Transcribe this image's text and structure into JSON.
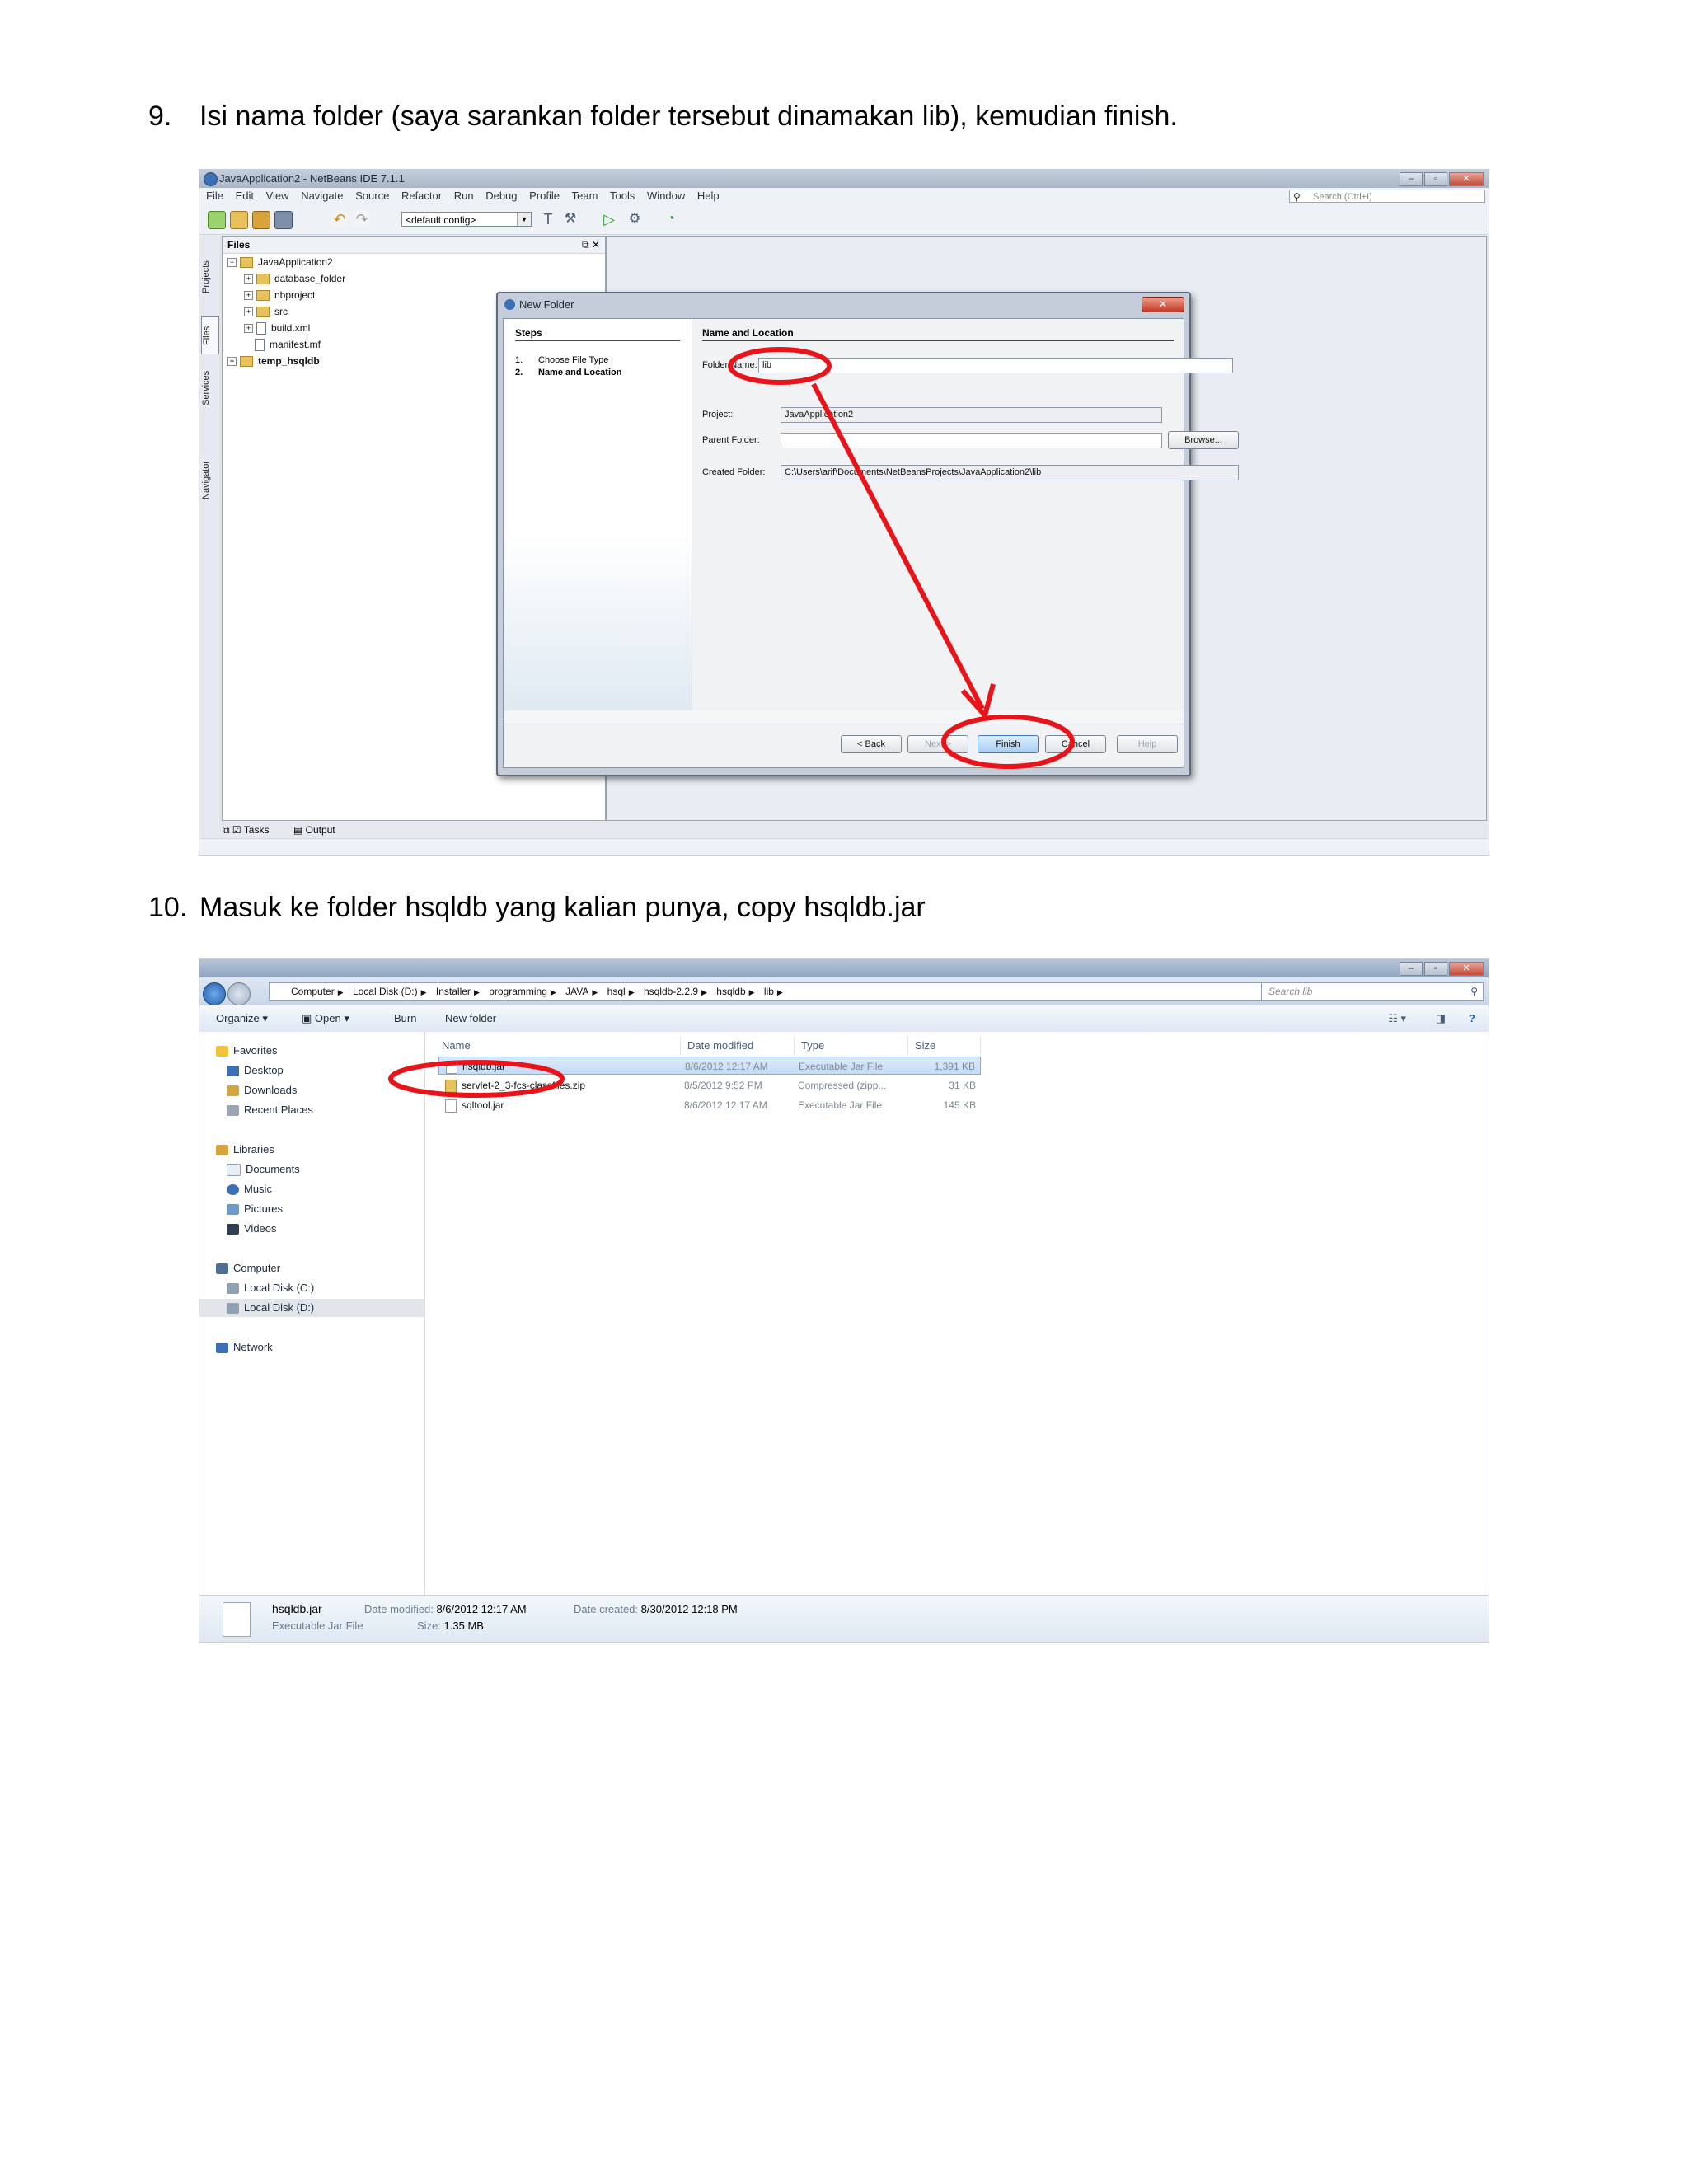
{
  "steps": [
    {
      "number": "9.",
      "text": "Isi nama folder (saya sarankan folder tersebut dinamakan lib), kemudian finish."
    },
    {
      "number": "10.",
      "text": "Masuk ke folder hsqldb yang kalian punya, copy hsqldb.jar"
    }
  ],
  "netbeans": {
    "window_title": "JavaApplication2 - NetBeans IDE 7.1.1",
    "menu": [
      "File",
      "Edit",
      "View",
      "Navigate",
      "Source",
      "Refactor",
      "Run",
      "Debug",
      "Profile",
      "Team",
      "Tools",
      "Window",
      "Help"
    ],
    "search_placeholder": "Search (Ctrl+I)",
    "config": "<default config>",
    "side_tabs": [
      "Projects",
      "Files",
      "Services",
      "Navigator"
    ],
    "files_panel_title": "Files",
    "tree": [
      "JavaApplication2",
      "database_folder",
      "nbproject",
      "src",
      "build.xml",
      "manifest.mf",
      "temp_hsqldb"
    ],
    "bottom_tabs": [
      "Tasks",
      "Output"
    ],
    "dialog": {
      "title": "New Folder",
      "steps_title": "Steps",
      "steps": [
        {
          "n": "1.",
          "label": "Choose File Type"
        },
        {
          "n": "2.",
          "label": "Name and Location"
        }
      ],
      "section_title": "Name and Location",
      "folder_name_label": "Folder Name:",
      "folder_name_value": "lib",
      "project_label": "Project:",
      "project_value": "JavaApplication2",
      "parent_folder_label": "Parent Folder:",
      "parent_folder_value": "",
      "browse": "Browse...",
      "created_folder_label": "Created Folder:",
      "created_folder_value": "C:\\Users\\arif\\Documents\\NetBeansProjects\\JavaApplication2\\lib",
      "buttons": {
        "back": "< Back",
        "next": "Next >",
        "finish": "Finish",
        "cancel": "Cancel",
        "help": "Help"
      }
    }
  },
  "explorer": {
    "breadcrumb": [
      "Computer",
      "Local Disk (D:)",
      "Installer",
      "programming",
      "JAVA",
      "hsql",
      "hsqldb-2.2.9",
      "hsqldb",
      "lib"
    ],
    "search_placeholder": "Search lib",
    "commands": {
      "organize": "Organize ▾",
      "open": "Open ▾",
      "burn": "Burn",
      "new_folder": "New folder"
    },
    "nav": {
      "favorites": "Favorites",
      "desktop": "Desktop",
      "downloads": "Downloads",
      "recent": "Recent Places",
      "libraries": "Libraries",
      "documents": "Documents",
      "music": "Music",
      "pictures": "Pictures",
      "videos": "Videos",
      "computer": "Computer",
      "local_c": "Local Disk (C:)",
      "local_d": "Local Disk (D:)",
      "network": "Network"
    },
    "columns": {
      "name": "Name",
      "date": "Date modified",
      "type": "Type",
      "size": "Size"
    },
    "files": [
      {
        "name": "hsqldb.jar",
        "date": "8/6/2012 12:17 AM",
        "type": "Executable Jar File",
        "size": "1,391 KB"
      },
      {
        "name": "servlet-2_3-fcs-classfiles.zip",
        "date": "8/5/2012 9:52 PM",
        "type": "Compressed (zipp...",
        "size": "31 KB"
      },
      {
        "name": "sqltool.jar",
        "date": "8/6/2012 12:17 AM",
        "type": "Executable Jar File",
        "size": "145 KB"
      }
    ],
    "details": {
      "name": "hsqldb.jar",
      "kind": "Executable Jar File",
      "modified_label": "Date modified:",
      "modified": "8/6/2012 12:17 AM",
      "created_label": "Date created:",
      "created": "8/30/2012 12:18 PM",
      "size_label": "Size:",
      "size": "1.35 MB"
    }
  },
  "colors": {
    "annotation": "#e8141a",
    "selection": "#c4dcf7"
  }
}
